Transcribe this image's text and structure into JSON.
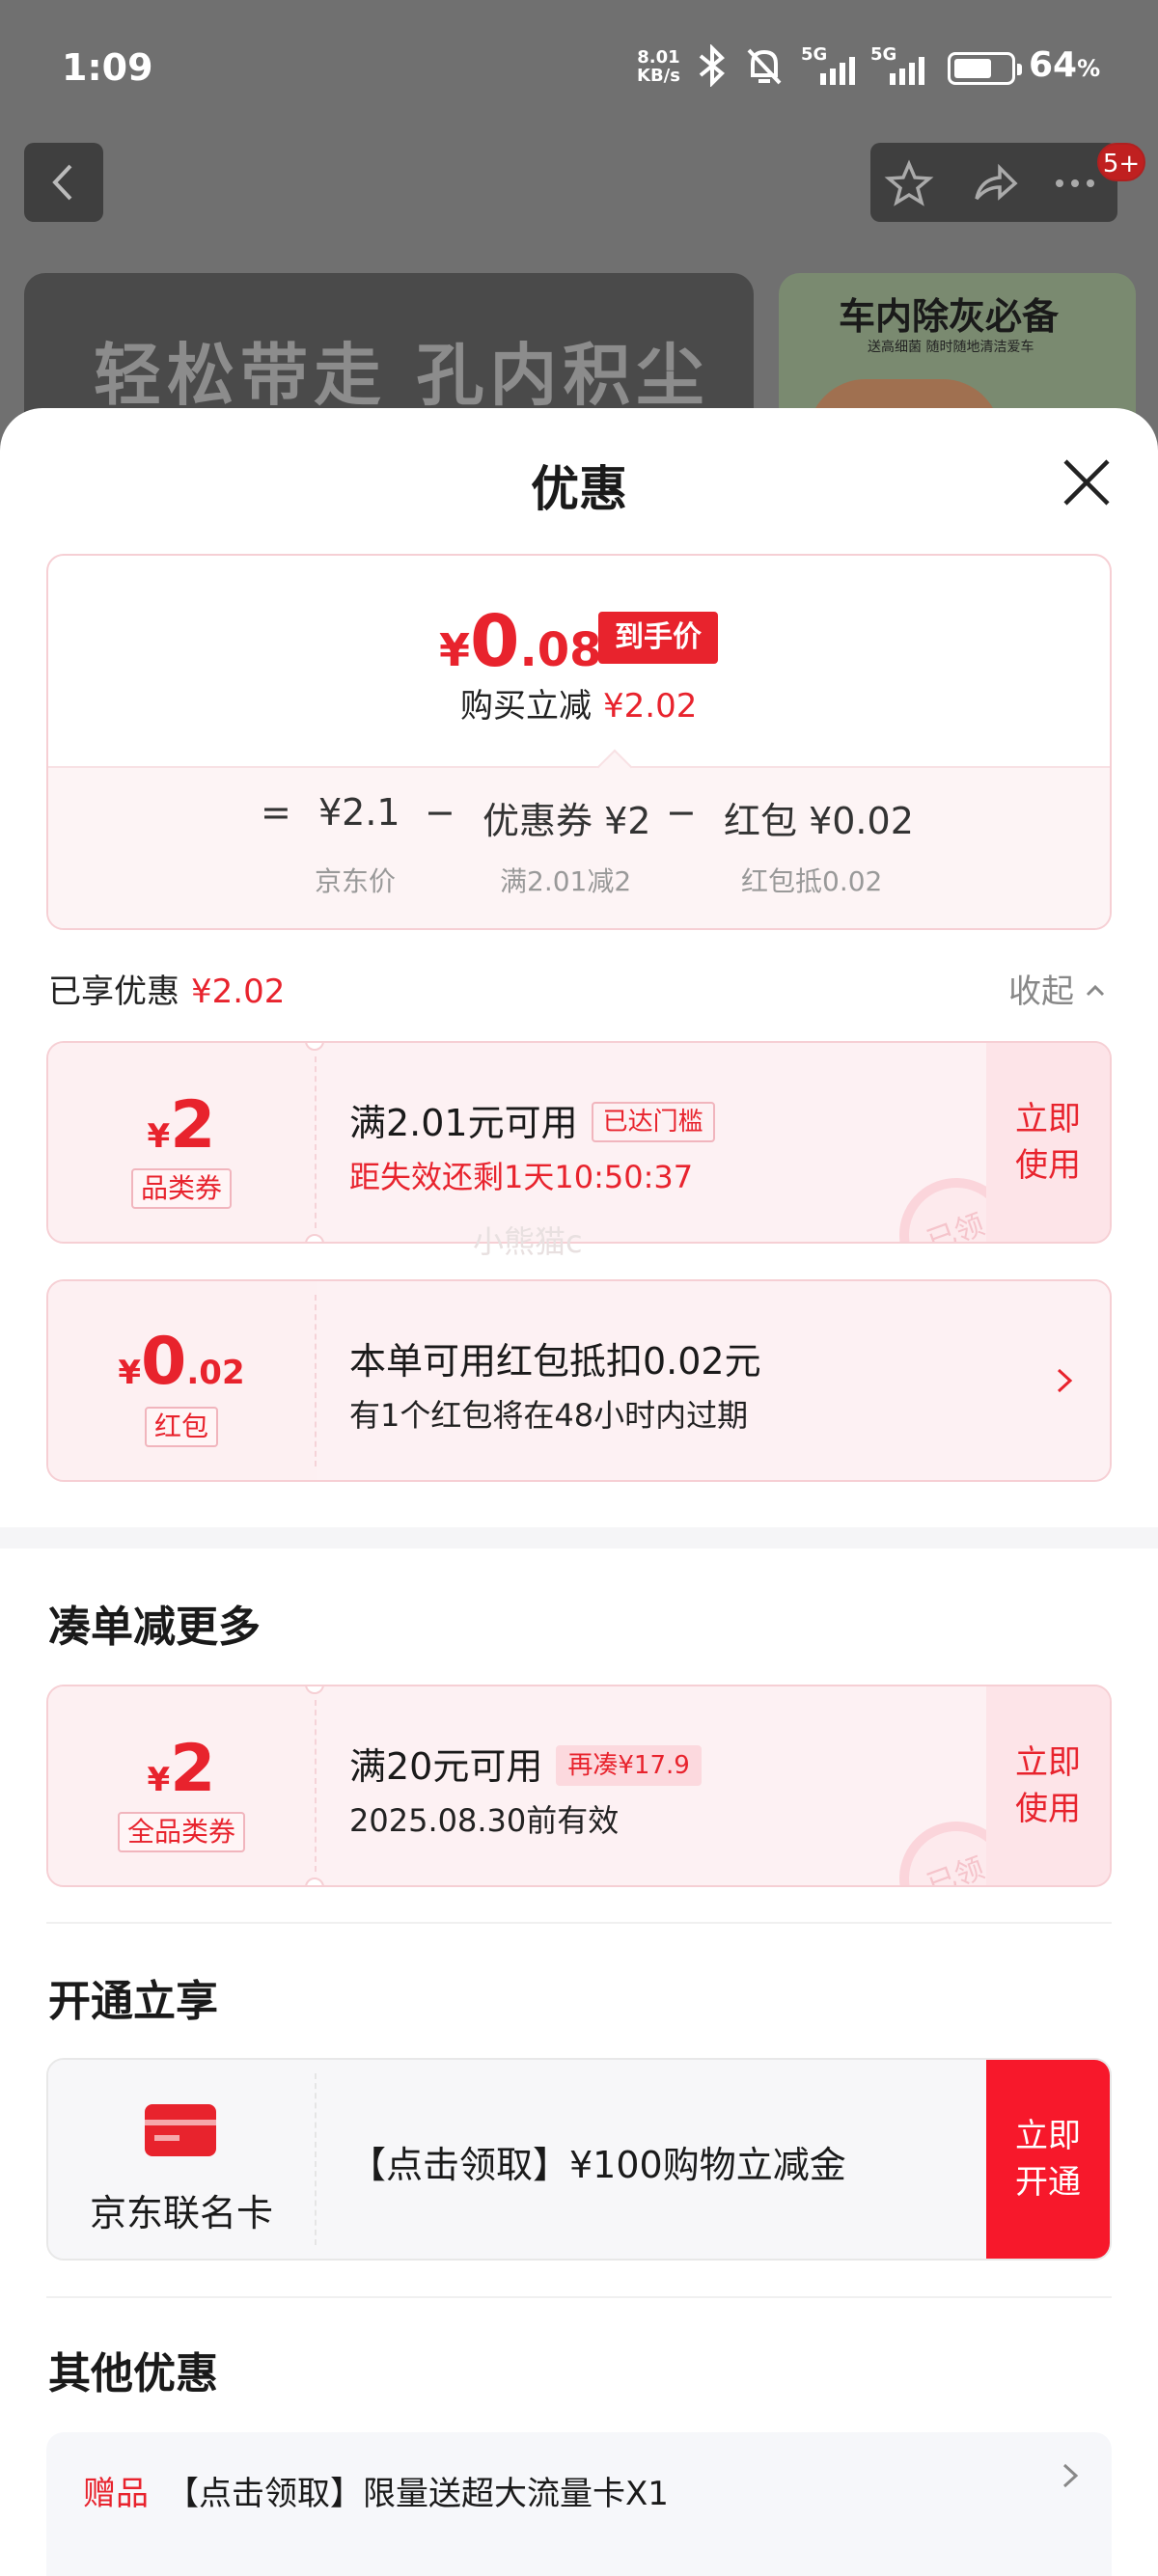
{
  "status_bar": {
    "time": "1:09",
    "net_speed_value": "8.01",
    "net_speed_unit": "KB/s",
    "signal1": "5G",
    "signal2": "5G",
    "battery": "64",
    "battery_unit": "%"
  },
  "background": {
    "notification_badge": "5+",
    "banner_left_text": "轻松带走 孔内积尘",
    "banner_right_title": "车内除灰必备",
    "banner_right_sub": "送高细菌 随时随地清洁爱车"
  },
  "sheet": {
    "title": "优惠"
  },
  "summary": {
    "currency": "¥",
    "price_int": "0",
    "price_dec": ".08",
    "price_tag": "到手价",
    "buy_label": "购买立减",
    "buy_amount": "¥2.02",
    "eq": "=",
    "jd_price": "¥2.1",
    "minus1": "−",
    "coupon_part": "优惠券 ¥2",
    "minus2": "−",
    "redpacket_part": "红包 ¥0.02",
    "jd_price_label": "京东价",
    "coupon_cond": "满2.01减2",
    "redpacket_cond": "红包抵0.02"
  },
  "enjoyed": {
    "label": "已享优惠",
    "amount": "¥2.02",
    "collapse": "收起"
  },
  "coupons": [
    {
      "currency": "¥",
      "amount": "2",
      "amount_dec": "",
      "type": "品类券",
      "line1": "满2.01元可用",
      "chip": "已达门槛",
      "line2": "距失效还剩1天10:50:37",
      "action": "立即使用",
      "stamp": "已领"
    },
    {
      "currency": "¥",
      "amount": "0",
      "amount_dec": ".02",
      "type": "红包",
      "line1": "本单可用红包抵扣0.02元",
      "line2": "有1个红包将在48小时内过期"
    }
  ],
  "watermark": "小熊猫c",
  "more_section": {
    "title": "凑单减更多",
    "coupon": {
      "currency": "¥",
      "amount": "2",
      "type": "全品类券",
      "line1": "满20元可用",
      "chip": "再凑¥17.9",
      "line2": "2025.08.30前有效",
      "action": "立即使用",
      "stamp": "已领"
    }
  },
  "open_section": {
    "title": "开通立享",
    "card_name": "京东联名卡",
    "text": "【点击领取】¥100购物立减金",
    "action": "立即开通"
  },
  "other_section": {
    "title": "其他优惠",
    "gift_label": "赠品",
    "gift_text": "【点击领取】限量送超大流量卡X1"
  },
  "colors": {
    "accent_red": "#e8232d",
    "coupon_bg": "#fdf0f2",
    "border_pink": "#f6cfd4"
  }
}
